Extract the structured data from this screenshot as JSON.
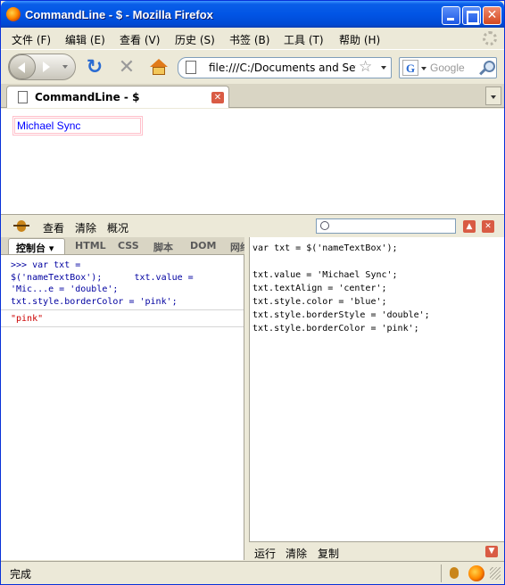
{
  "window": {
    "title": "CommandLine - $ - Mozilla Firefox"
  },
  "menubar": {
    "items": [
      {
        "label": "文件 (F)"
      },
      {
        "label": "编辑 (E)"
      },
      {
        "label": "查看 (V)"
      },
      {
        "label": "历史 (S)"
      },
      {
        "label": "书签 (B)"
      },
      {
        "label": "工具 (T)"
      },
      {
        "label": "帮助 (H)"
      }
    ]
  },
  "navbar": {
    "url": "file:///C:/Documents and Settings",
    "search_placeholder": "Google",
    "search_engine_glyph": "G"
  },
  "tabs": [
    {
      "label": "CommandLine - $"
    }
  ],
  "page": {
    "name_textbox_value": "Michael Sync",
    "name_textbox_color": "#0000ff",
    "name_textbox_border_color": "#ffc0cb"
  },
  "firebug": {
    "toolbar": {
      "inspect": "查看",
      "clear": "清除",
      "profile": "概况"
    },
    "panel_tabs": [
      {
        "label": "控制台 ▾"
      },
      {
        "label": "HTML"
      },
      {
        "label": "CSS"
      },
      {
        "label": "脚本"
      },
      {
        "label": "DOM"
      },
      {
        "label": "网络"
      }
    ],
    "console": {
      "command_lines": [
        ">>> var txt =",
        "$('nameTextBox');      txt.value =",
        "'Mic...e = 'double';",
        "txt.style.borderColor = 'pink';"
      ],
      "result": "\"pink\""
    },
    "editor": {
      "lines": [
        "var txt = $('nameTextBox');",
        "",
        "txt.value = 'Michael Sync';",
        "txt.textAlign = 'center';",
        "txt.style.color = 'blue';",
        "txt.style.borderStyle = 'double';",
        "txt.style.borderColor = 'pink';"
      ],
      "actions": {
        "run": "运行",
        "clear": "清除",
        "copy": "复制"
      }
    }
  },
  "statusbar": {
    "text": "完成"
  }
}
